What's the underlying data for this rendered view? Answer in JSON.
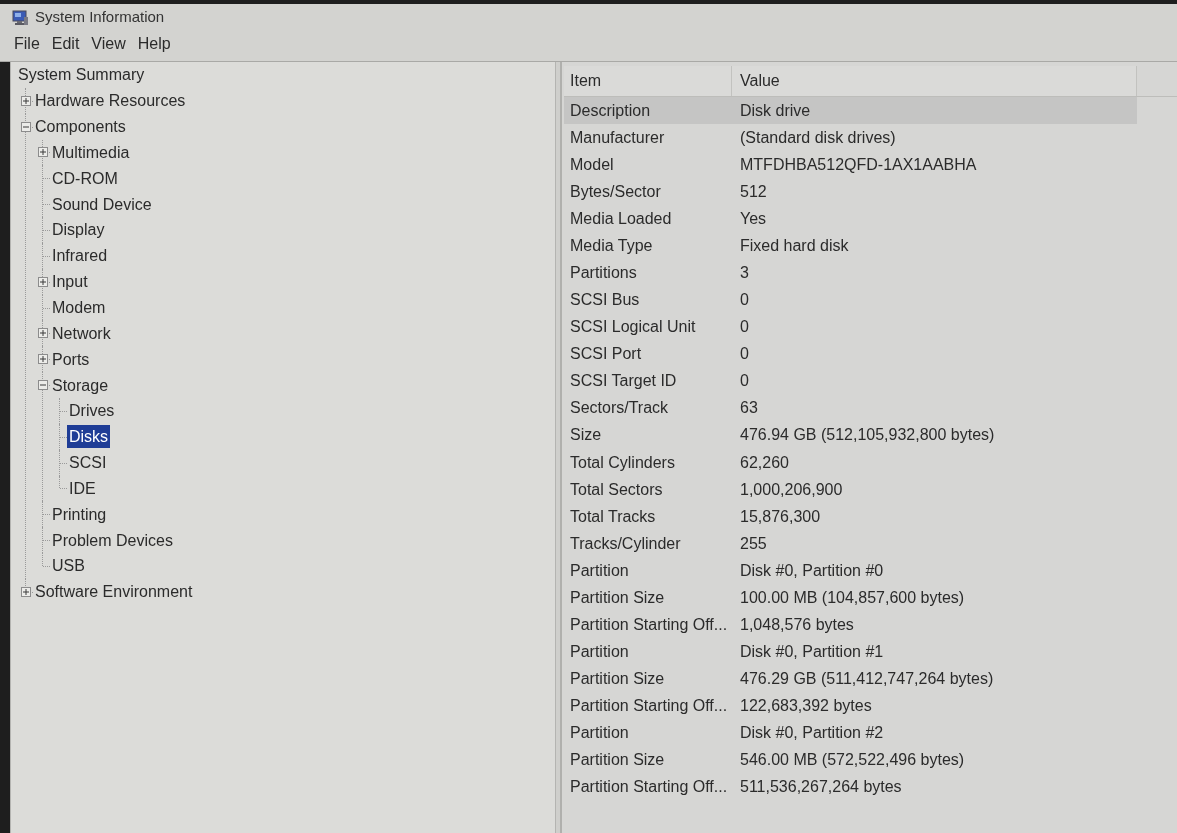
{
  "window": {
    "title": "System Information"
  },
  "menu": [
    "File",
    "Edit",
    "View",
    "Help"
  ],
  "tree": [
    {
      "label": "System Summary",
      "selected": false,
      "children": [
        {
          "label": "Hardware Resources",
          "selected": false,
          "expanded": false
        },
        {
          "label": "Components",
          "selected": false,
          "expanded": true,
          "children": [
            {
              "label": "Multimedia",
              "selected": false,
              "expanded": false
            },
            {
              "label": "CD-ROM",
              "selected": false
            },
            {
              "label": "Sound Device",
              "selected": false
            },
            {
              "label": "Display",
              "selected": false
            },
            {
              "label": "Infrared",
              "selected": false
            },
            {
              "label": "Input",
              "selected": false,
              "expanded": false
            },
            {
              "label": "Modem",
              "selected": false
            },
            {
              "label": "Network",
              "selected": false,
              "expanded": false
            },
            {
              "label": "Ports",
              "selected": false,
              "expanded": false
            },
            {
              "label": "Storage",
              "selected": false,
              "expanded": true,
              "children": [
                {
                  "label": "Drives",
                  "selected": false
                },
                {
                  "label": "Disks",
                  "selected": true
                },
                {
                  "label": "SCSI",
                  "selected": false
                },
                {
                  "label": "IDE",
                  "selected": false
                }
              ]
            },
            {
              "label": "Printing",
              "selected": false
            },
            {
              "label": "Problem Devices",
              "selected": false
            },
            {
              "label": "USB",
              "selected": false
            }
          ]
        },
        {
          "label": "Software Environment",
          "selected": false,
          "expanded": false
        }
      ]
    }
  ],
  "table": {
    "columns": [
      "Item",
      "Value"
    ],
    "rows": [
      {
        "item": "Description",
        "value": "Disk drive",
        "selected": true
      },
      {
        "item": "Manufacturer",
        "value": "(Standard disk drives)",
        "selected": false
      },
      {
        "item": "Model",
        "value": "MTFDHBA512QFD-1AX1AABHA",
        "selected": false
      },
      {
        "item": "Bytes/Sector",
        "value": "512",
        "selected": false
      },
      {
        "item": "Media Loaded",
        "value": "Yes",
        "selected": false
      },
      {
        "item": "Media Type",
        "value": "Fixed hard disk",
        "selected": false
      },
      {
        "item": "Partitions",
        "value": "3",
        "selected": false
      },
      {
        "item": "SCSI Bus",
        "value": "0",
        "selected": false
      },
      {
        "item": "SCSI Logical Unit",
        "value": "0",
        "selected": false
      },
      {
        "item": "SCSI Port",
        "value": "0",
        "selected": false
      },
      {
        "item": "SCSI Target ID",
        "value": "0",
        "selected": false
      },
      {
        "item": "Sectors/Track",
        "value": "63",
        "selected": false
      },
      {
        "item": "Size",
        "value": "476.94 GB (512,105,932,800 bytes)",
        "selected": false
      },
      {
        "item": "Total Cylinders",
        "value": "62,260",
        "selected": false
      },
      {
        "item": "Total Sectors",
        "value": "1,000,206,900",
        "selected": false
      },
      {
        "item": "Total Tracks",
        "value": "15,876,300",
        "selected": false
      },
      {
        "item": "Tracks/Cylinder",
        "value": "255",
        "selected": false
      },
      {
        "item": "Partition",
        "value": "Disk #0, Partition #0",
        "selected": false
      },
      {
        "item": "Partition Size",
        "value": "100.00 MB (104,857,600 bytes)",
        "selected": false
      },
      {
        "item": "Partition Starting Off...",
        "value": "1,048,576 bytes",
        "selected": false
      },
      {
        "item": "Partition",
        "value": "Disk #0, Partition #1",
        "selected": false
      },
      {
        "item": "Partition Size",
        "value": "476.29 GB (511,412,747,264 bytes)",
        "selected": false
      },
      {
        "item": "Partition Starting Off...",
        "value": "122,683,392 bytes",
        "selected": false
      },
      {
        "item": "Partition",
        "value": "Disk #0, Partition #2",
        "selected": false
      },
      {
        "item": "Partition Size",
        "value": "546.00 MB (572,522,496 bytes)",
        "selected": false
      },
      {
        "item": "Partition Starting Off...",
        "value": "511,536,267,264 bytes",
        "selected": false
      }
    ]
  }
}
